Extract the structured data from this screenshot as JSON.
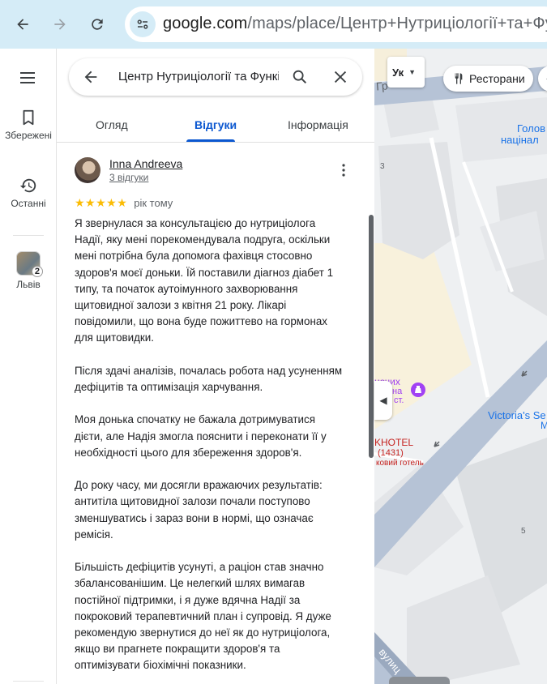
{
  "browser": {
    "url_host": "google.com",
    "url_path": "/maps/place/Центр+Нутриціології+та+Функ"
  },
  "rail": {
    "items": [
      {
        "label": "Збережені",
        "icon": "bookmark-icon"
      },
      {
        "label": "Останні",
        "icon": "history-icon"
      },
      {
        "label": "Львів",
        "icon": "lviv-thumbnail",
        "badge": "2"
      }
    ]
  },
  "search": {
    "value": "Центр Нутриціології та Функі"
  },
  "tabs": [
    {
      "label": "Огляд",
      "active": false
    },
    {
      "label": "Відгуки",
      "active": true
    },
    {
      "label": "Інформація",
      "active": false
    }
  ],
  "review": {
    "author": "Inna Andreeva",
    "author_sub": "3 відгуки",
    "stars": "★★★★★",
    "rating": 5,
    "time": "рік тому",
    "paragraphs": [
      "Я звернулася за консультацією до нутриціолога\nНадії, яку мені порекомендувала подруга, оскільки\nмені потрібна була допомога фахівця стосовно\nздоров'я моєї доньки. Їй поставили діагноз діабет 1\nтипу, та початок аутоімунного захворювання\nщитовидної залози з квітня 21 року. Лікарі\nповідомили, що вона буде пожиттево на гормонах\nдля щитовидки.",
      "Після здачі аналізів, почалась робота над усуненням\nдефіцитів та оптимізація харчування.",
      "Моя донька спочатку не бажала дотримуватися\nдієти, але Надія змогла пояснити і переконати її у\nнеобхідності цього для збереження здоров'я.",
      "До року часу, ми досягли вражаючих результатів:\nантитіла щитовидної залози почали поступово\nзменшуватись і зараз вони в нормі, що означає\nремісія.",
      "Більшість дефіцитів усунуті, а раціон став значно\nзбалансованішим. Це нелегкий шлях вимагав\nпостійної підтримки, і я дуже вдячна Надії за\nпокроковий терапевтичний план і супровід. Я дуже\nрекомендую звернутися до неї як до нутриціолога,\nякщо ви прагнете покращити здоров'я та\nоптимізувати біохімічні показники."
    ]
  },
  "map": {
    "layers_chip": "Ук",
    "restaurants_chip": "Ресторани",
    "labels": [
      {
        "text": "Гр",
        "color": "#5f6368"
      },
      {
        "text": "Голов",
        "color": "#1a73e8"
      },
      {
        "text": "націнал",
        "color": "#1a73e8"
      },
      {
        "text": "3",
        "color": "#5f6368"
      },
      {
        "text": "нечих",
        "color": "#a142f4"
      },
      {
        "text": "на",
        "color": "#a142f4"
      },
      {
        "text": "ст.",
        "color": "#a142f4"
      },
      {
        "text": "Victoria's Se",
        "color": "#1a73e8"
      },
      {
        "text": "M",
        "color": "#1a73e8"
      },
      {
        "text": "KHOTEL",
        "color": "#c5221f"
      },
      {
        "text": "(1431)",
        "color": "#c5221f"
      },
      {
        "text": "ковий готель",
        "color": "#c5221f"
      },
      {
        "text": "5",
        "color": "#5f6368"
      },
      {
        "text": "вулиц",
        "color": "#ffffff"
      }
    ]
  },
  "colors": {
    "accent": "#0b57d0",
    "star": "#fbbc04",
    "chrome": "#d5ecf7"
  }
}
